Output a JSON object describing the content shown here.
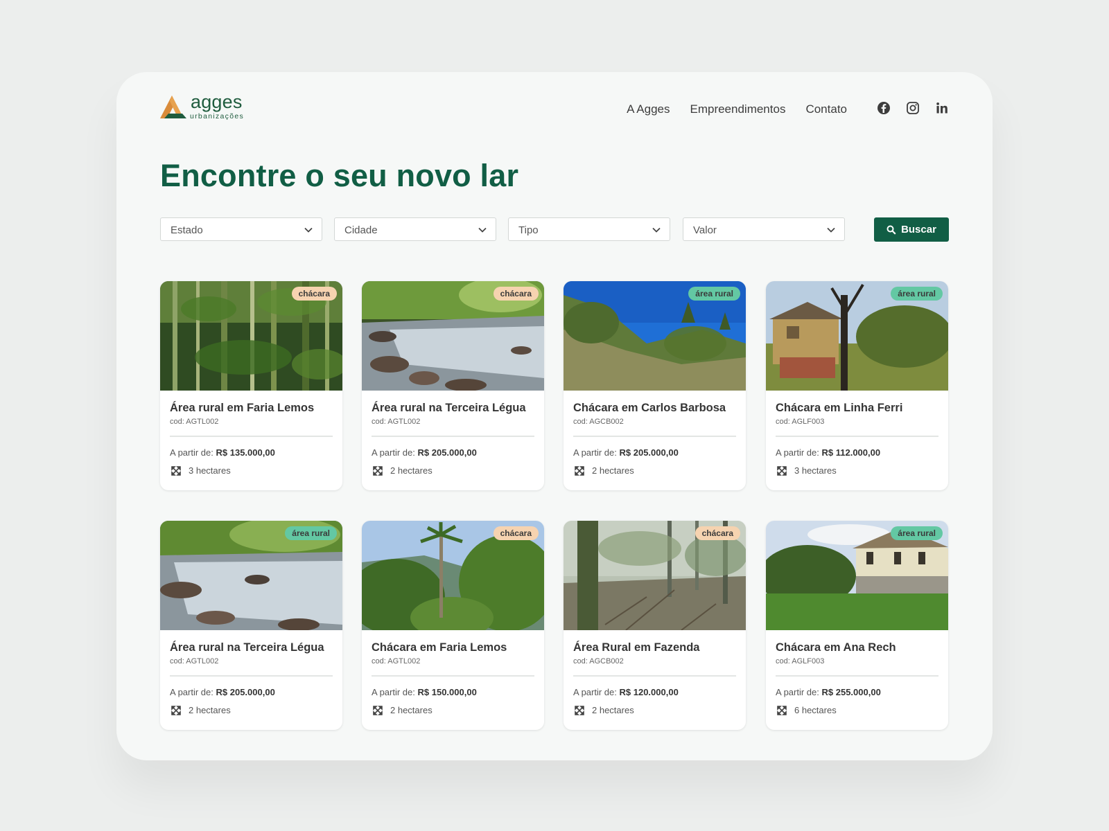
{
  "brand": {
    "name": "agges",
    "subtitle": "urbanizações",
    "colors": {
      "primary": "#115e45",
      "logo_orange": "#d98b3a",
      "logo_green": "#1f5c3e"
    }
  },
  "nav": {
    "items": [
      "A Agges",
      "Empreendimentos",
      "Contato"
    ]
  },
  "social": [
    "facebook-icon",
    "instagram-icon",
    "linkedin-icon"
  ],
  "page_title": "Encontre o seu novo lar",
  "filters": {
    "estado": "Estado",
    "cidade": "Cidade",
    "tipo": "Tipo",
    "valor": "Valor",
    "search_button": "Buscar"
  },
  "labels": {
    "price_prefix": "A partir de:"
  },
  "listings": [
    {
      "title": "Área rural em Faria Lemos",
      "code": "cod: AGTL002",
      "price": "R$ 135.000,00",
      "area": "3 hectares",
      "badge": "chácara",
      "badge_type": "chacara",
      "image": "bamboo-forest"
    },
    {
      "title": "Área rural na Terceira Légua",
      "code": "cod: AGTL002",
      "price": "R$ 205.000,00",
      "area": "2 hectares",
      "badge": "chácara",
      "badge_type": "chacara",
      "image": "river-stream"
    },
    {
      "title": "Chácara em Carlos Barbosa",
      "code": "cod: AGCB002",
      "price": "R$ 205.000,00",
      "area": "2 hectares",
      "badge": "área rural",
      "badge_type": "rural",
      "image": "hillside-sky"
    },
    {
      "title": "Chácara em Linha Ferri",
      "code": "cod: AGLF003",
      "price": "R$ 112.000,00",
      "area": "3 hectares",
      "badge": "área rural",
      "badge_type": "rural",
      "image": "wooden-house"
    },
    {
      "title": "Área rural na Terceira Légua",
      "code": "cod: AGTL002",
      "price": "R$ 205.000,00",
      "area": "2 hectares",
      "badge": "área rural",
      "badge_type": "rural",
      "image": "river-stream"
    },
    {
      "title": "Chácara em Faria Lemos",
      "code": "cod: AGTL002",
      "price": "R$ 150.000,00",
      "area": "2 hectares",
      "badge": "chácara",
      "badge_type": "chacara",
      "image": "palm-valley"
    },
    {
      "title": "Área Rural em Fazenda",
      "code": "cod: AGCB002",
      "price": "R$ 120.000,00",
      "area": "2 hectares",
      "badge": "chácara",
      "badge_type": "chacara",
      "image": "forest-clearing"
    },
    {
      "title": "Chácara em Ana Rech",
      "code": "cod: AGLF003",
      "price": "R$ 255.000,00",
      "area": "6 hectares",
      "badge": "área rural",
      "badge_type": "rural",
      "image": "stone-house-lawn"
    }
  ]
}
